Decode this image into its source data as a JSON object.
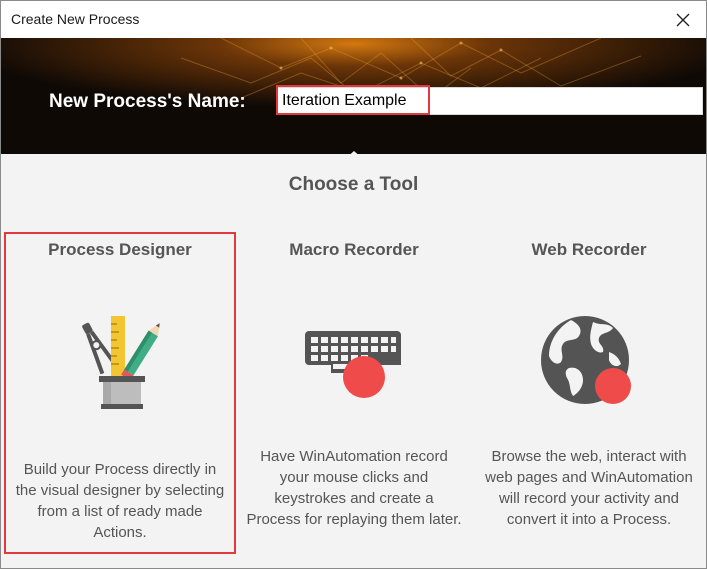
{
  "window": {
    "title": "Create New Process"
  },
  "banner": {
    "name_label": "New Process's Name:",
    "name_value": "Iteration Example"
  },
  "main": {
    "heading": "Choose a Tool",
    "tools": [
      {
        "name": "Process Designer",
        "description": "Build your Process directly in the visual designer by selecting from a list of ready made Actions.",
        "icon": "pencil-cup-icon",
        "selected": true
      },
      {
        "name": "Macro Recorder",
        "description": "Have WinAutomation record your mouse clicks and keystrokes and create a Process for replaying them later.",
        "icon": "keyboard-record-icon",
        "selected": false
      },
      {
        "name": "Web Recorder",
        "description": "Browse the web, interact with web pages and WinAutomation will record your activity and convert it into a Process.",
        "icon": "globe-record-icon",
        "selected": false
      }
    ]
  },
  "colors": {
    "highlight": "#e0393e",
    "record_dot": "#ef4b4b",
    "icon_dark": "#545454",
    "text": "#555555"
  }
}
